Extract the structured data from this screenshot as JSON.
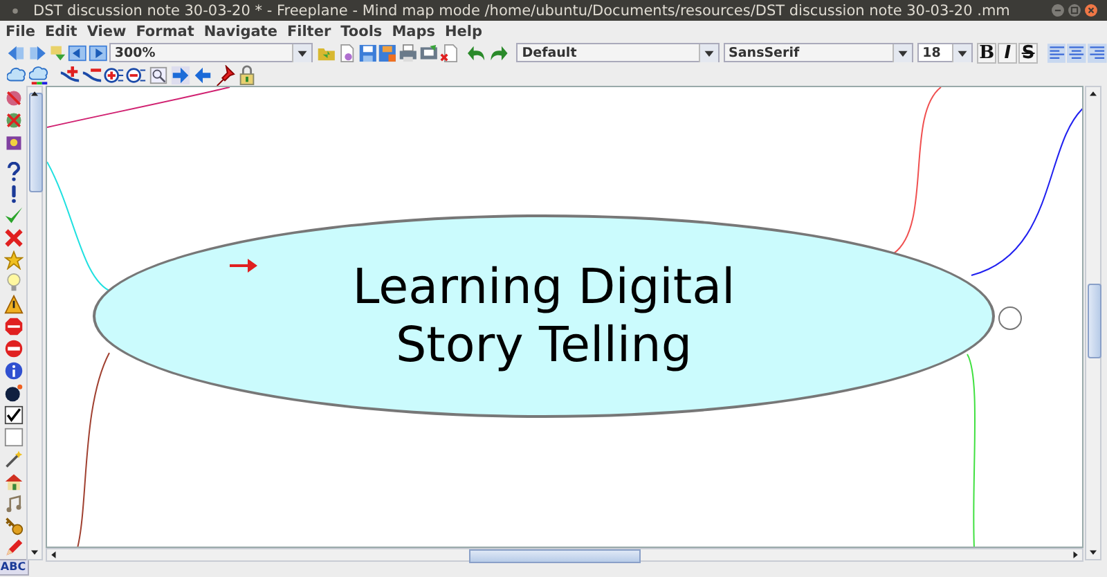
{
  "window": {
    "title": "DST discussion note  30-03-20 * - Freeplane - Mind map mode /home/ubuntu/Documents/resources/DST discussion note  30-03-20 .mm"
  },
  "menu": [
    "File",
    "Edit",
    "View",
    "Format",
    "Navigate",
    "Filter",
    "Tools",
    "Maps",
    "Help"
  ],
  "toolbar": {
    "zoom": "300%",
    "style": "Default",
    "font": "SansSerif",
    "size": "18",
    "format_buttons": [
      "B",
      "I",
      "S"
    ]
  },
  "map": {
    "root": {
      "text": "Learning Digital\nStory Telling"
    }
  },
  "icon_bar": {
    "spell_button": "ABC"
  }
}
